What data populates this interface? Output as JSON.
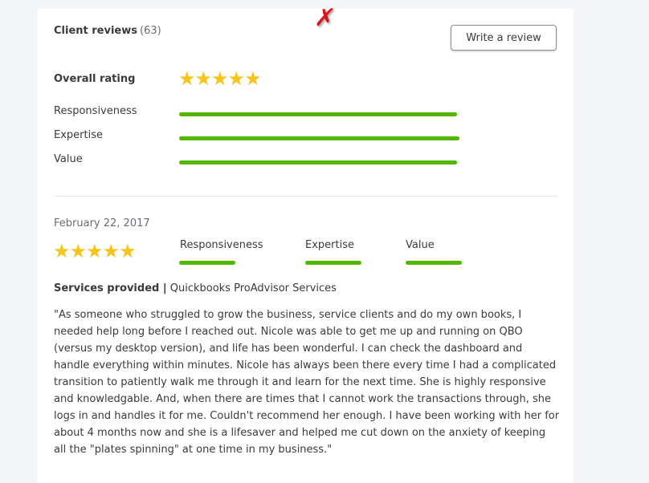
{
  "header": {
    "title": "Client reviews",
    "count": "(63)",
    "write_review_label": "Write a review"
  },
  "overall": {
    "label": "Overall rating",
    "stars": 5,
    "metrics": [
      {
        "label": "Responsiveness",
        "fill_fraction": 0.99
      },
      {
        "label": "Expertise",
        "fill_fraction": 1.0
      },
      {
        "label": "Value",
        "fill_fraction": 0.99
      }
    ]
  },
  "review": {
    "date": "February 22, 2017",
    "stars": 5,
    "metrics": [
      {
        "label": "Responsiveness",
        "fill_fraction": 1.0
      },
      {
        "label": "Expertise",
        "fill_fraction": 1.0
      },
      {
        "label": "Value",
        "fill_fraction": 1.0
      }
    ],
    "services_label": "Services provided |",
    "services_value": "Quickbooks ProAdvisor Services",
    "text": "\"As someone who struggled to grow the business, service clients and do my own books, I needed help long before I reached out. Nicole was able to get me up and running on QBO (versus my desktop version), and life has been wonderful.  I can check the dashboard and handle everything within minutes.  Nicole has always been there every time I had a complicated transition to patiently walk me through it and learn for the next time.  She is highly responsive and knowledgable.  And, when there are times that I cannot work the transactions through, she logs in and handles it for me.  Couldn't recommend her enough.  I have been working with her for about 4 months now and she is a lifesaver and helped me cut down on the anxiety of keeping all the \"plates spinning\" at one time in my business.\""
  },
  "annotation": {
    "mark": "✗",
    "icon": "red-x-mark-icon",
    "color": "#e0101a"
  },
  "colors": {
    "star": "#f8c41a",
    "bar": "#53b700"
  }
}
